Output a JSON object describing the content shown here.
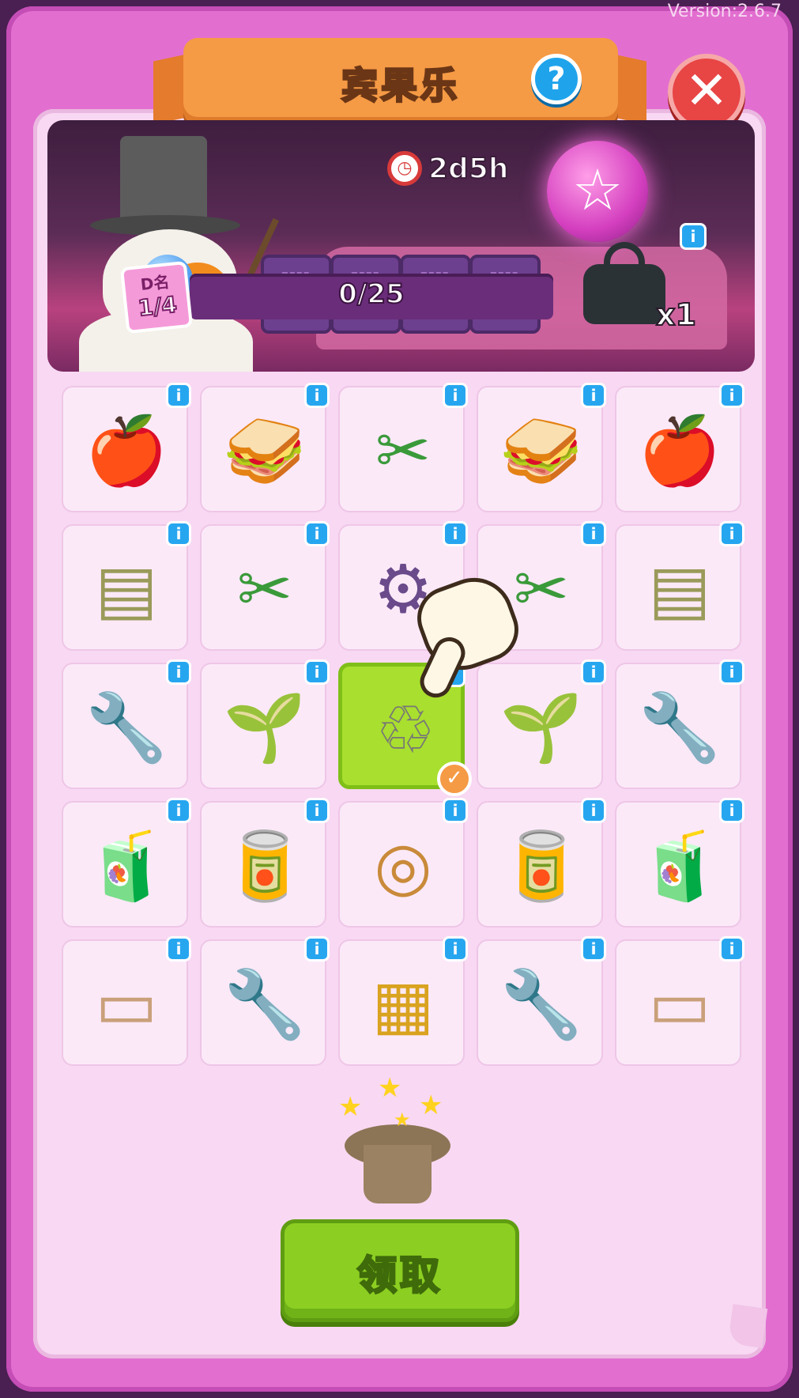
{
  "version": "Version:2.6.7",
  "header": {
    "title": "宾果乐",
    "help_icon": "question-mark",
    "close_icon": "x"
  },
  "banner": {
    "timer_icon": "clock",
    "timer": "2d5h",
    "rank_label": "D名",
    "rank_value": "1/4",
    "progress_text": "0/25",
    "progress_value": 0,
    "progress_max": 25,
    "bag_count": "x1",
    "info_icon": "i"
  },
  "grid": {
    "rows": [
      [
        "apple-core",
        "sandwich",
        "pruning-shears",
        "sandwich",
        "apple-core"
      ],
      [
        "seed-bag",
        "wire-cutters",
        "grinder-box",
        "wire-cutters",
        "seed-bag"
      ],
      [
        "wrench",
        "plant-jar",
        "garbage-bag",
        "plant-jar",
        "wrench"
      ],
      [
        "juice-bottle",
        "soda-can",
        "bagel",
        "soda-can",
        "juice-bottle"
      ],
      [
        "paper-roll",
        "wrench",
        "drawer-cabinet",
        "wrench",
        "paper-roll"
      ]
    ],
    "info_label": "i",
    "selected_check": "✓"
  },
  "reward_icon": "magic-hat-fireworks",
  "claim_label": "领取",
  "colors": {
    "frame": "#e26fd0",
    "panel": "#f8d8f2",
    "ribbon": "#f59a45",
    "close": "#e84545",
    "info": "#27a6f0",
    "highlight": "#a9df2e",
    "claim": "#8ccf22"
  }
}
